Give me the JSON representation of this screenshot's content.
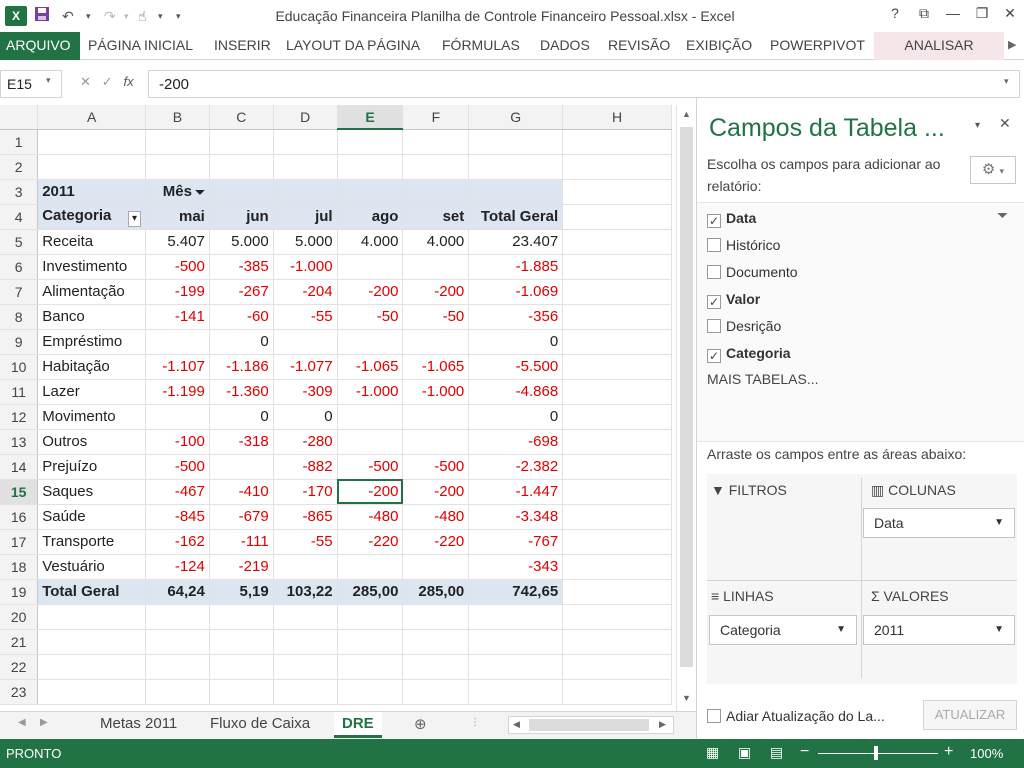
{
  "window": {
    "title": "Educação Financeira Planilha de Controle Financeiro Pessoal.xlsx - Excel",
    "app_icon": "X",
    "help": "?",
    "minimize": "—",
    "restore": "❐",
    "close": "✕",
    "restore_ribbon": "⧉"
  },
  "ribbon": {
    "tabs": [
      "ARQUIVO",
      "PÁGINA INICIAL",
      "INSERIR",
      "LAYOUT DA PÁGINA",
      "FÓRMULAS",
      "DADOS",
      "REVISÃO",
      "EXIBIÇÃO",
      "POWERPIVOT"
    ],
    "context_tab": "ANALISAR"
  },
  "formula_bar": {
    "name_box": "E15",
    "value": "-200"
  },
  "grid": {
    "columns": [
      "A",
      "B",
      "C",
      "D",
      "E",
      "F",
      "G",
      "H"
    ],
    "selected_column": "E",
    "selected_row": "15",
    "rows": [
      {
        "n": "1",
        "cells": [
          "",
          "",
          "",
          "",
          "",
          "",
          "",
          ""
        ]
      },
      {
        "n": "2",
        "cells": [
          "",
          "",
          "",
          "",
          "",
          "",
          "",
          ""
        ]
      },
      {
        "n": "3",
        "cells": [
          "2011",
          "Mês",
          "",
          "",
          "",
          "",
          "",
          ""
        ]
      },
      {
        "n": "4",
        "cells": [
          "Categoria",
          "mai",
          "jun",
          "jul",
          "ago",
          "set",
          "Total Geral",
          ""
        ]
      },
      {
        "n": "5",
        "cells": [
          "Receita",
          "5.407",
          "5.000",
          "5.000",
          "4.000",
          "4.000",
          "23.407",
          ""
        ]
      },
      {
        "n": "6",
        "cells": [
          "Investimento",
          "-500",
          "-385",
          "-1.000",
          "",
          "",
          "-1.885",
          ""
        ]
      },
      {
        "n": "7",
        "cells": [
          "Alimentação",
          "-199",
          "-267",
          "-204",
          "-200",
          "-200",
          "-1.069",
          ""
        ]
      },
      {
        "n": "8",
        "cells": [
          "Banco",
          "-141",
          "-60",
          "-55",
          "-50",
          "-50",
          "-356",
          ""
        ]
      },
      {
        "n": "9",
        "cells": [
          "Empréstimo",
          "",
          "0",
          "",
          "",
          "",
          "0",
          ""
        ]
      },
      {
        "n": "10",
        "cells": [
          "Habitação",
          "-1.107",
          "-1.186",
          "-1.077",
          "-1.065",
          "-1.065",
          "-5.500",
          ""
        ]
      },
      {
        "n": "11",
        "cells": [
          "Lazer",
          "-1.199",
          "-1.360",
          "-309",
          "-1.000",
          "-1.000",
          "-4.868",
          ""
        ]
      },
      {
        "n": "12",
        "cells": [
          "Movimento",
          "",
          "0",
          "0",
          "",
          "",
          "0",
          ""
        ]
      },
      {
        "n": "13",
        "cells": [
          "Outros",
          "-100",
          "-318",
          "-280",
          "",
          "",
          "-698",
          ""
        ]
      },
      {
        "n": "14",
        "cells": [
          "Prejuízo",
          "-500",
          "",
          "-882",
          "-500",
          "-500",
          "-2.382",
          ""
        ]
      },
      {
        "n": "15",
        "cells": [
          "Saques",
          "-467",
          "-410",
          "-170",
          "-200",
          "-200",
          "-1.447",
          ""
        ]
      },
      {
        "n": "16",
        "cells": [
          "Saúde",
          "-845",
          "-679",
          "-865",
          "-480",
          "-480",
          "-3.348",
          ""
        ]
      },
      {
        "n": "17",
        "cells": [
          "Transporte",
          "-162",
          "-111",
          "-55",
          "-220",
          "-220",
          "-767",
          ""
        ]
      },
      {
        "n": "18",
        "cells": [
          "Vestuário",
          "-124",
          "-219",
          "",
          "",
          "",
          "-343",
          ""
        ]
      },
      {
        "n": "19",
        "cells": [
          "Total Geral",
          "64,24",
          "5,19",
          "103,22",
          "285,00",
          "285,00",
          "742,65",
          ""
        ]
      },
      {
        "n": "20",
        "cells": [
          "",
          "",
          "",
          "",
          "",
          "",
          "",
          ""
        ]
      },
      {
        "n": "21",
        "cells": [
          "",
          "",
          "",
          "",
          "",
          "",
          "",
          ""
        ]
      },
      {
        "n": "22",
        "cells": [
          "",
          "",
          "",
          "",
          "",
          "",
          "",
          ""
        ]
      },
      {
        "n": "23",
        "cells": [
          "",
          "",
          "",
          "",
          "",
          "",
          "",
          ""
        ]
      }
    ]
  },
  "sheet_tabs": [
    "Metas 2011",
    "Fluxo de Caixa",
    "DRE"
  ],
  "active_sheet": "DRE",
  "status": {
    "ready": "PRONTO",
    "zoom": "100%"
  },
  "pivot_pane": {
    "title": "Campos da Tabela ...",
    "instructions": "Escolha os campos para adicionar ao relatório:",
    "fields": [
      {
        "label": "Data",
        "checked": true
      },
      {
        "label": "Histórico",
        "checked": false
      },
      {
        "label": "Documento",
        "checked": false
      },
      {
        "label": "Valor",
        "checked": true
      },
      {
        "label": "Desrição",
        "checked": false
      },
      {
        "label": "Categoria",
        "checked": true
      }
    ],
    "more_tables": "MAIS TABELAS...",
    "drag_hint": "Arraste os campos entre as áreas abaixo:",
    "areas": {
      "filters": "FILTROS",
      "columns": "COLUNAS",
      "rows": "LINHAS",
      "values": "VALORES"
    },
    "columns_item": "Data",
    "rows_item": "Categoria",
    "values_item": "2011",
    "defer_label": "Adiar Atualização do La...",
    "update_button": "ATUALIZAR"
  }
}
